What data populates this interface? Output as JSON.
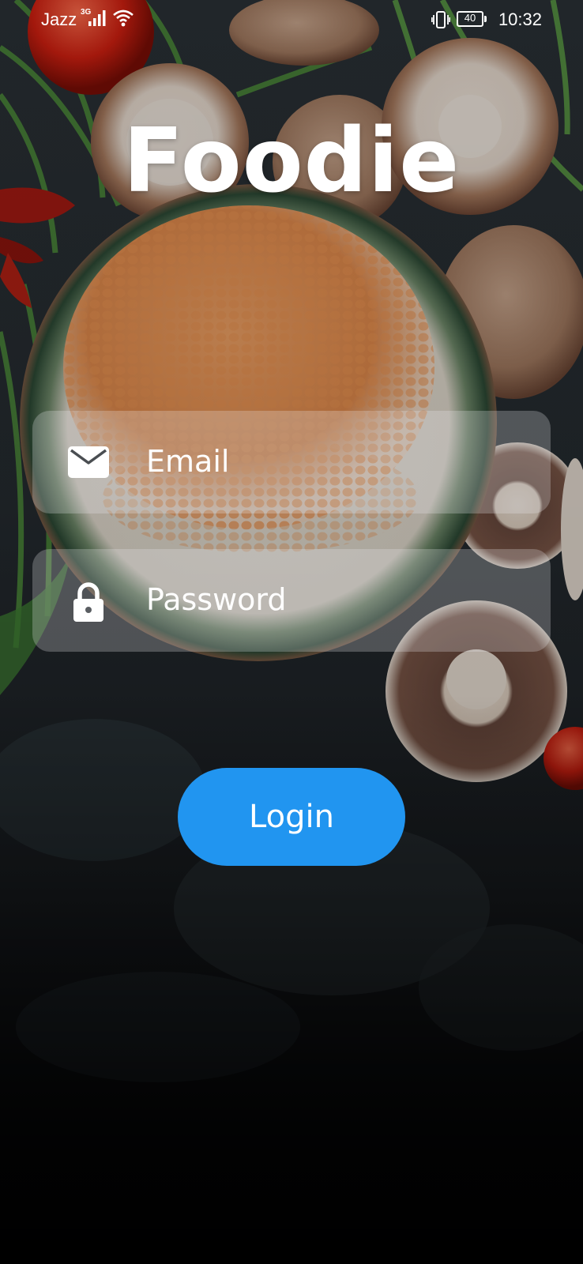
{
  "status_bar": {
    "carrier": "Jazz",
    "network_type": "3G",
    "battery_level": "40",
    "time": "10:32"
  },
  "app": {
    "title": "Foodie"
  },
  "form": {
    "email_placeholder": "Email",
    "password_placeholder": "Password",
    "login_label": "Login"
  },
  "icons": {
    "email": "mail-icon",
    "password": "lock-icon"
  },
  "colors": {
    "accent": "#2195f0",
    "field_bg": "rgba(235,235,240,0.26)",
    "text": "#ffffff"
  }
}
